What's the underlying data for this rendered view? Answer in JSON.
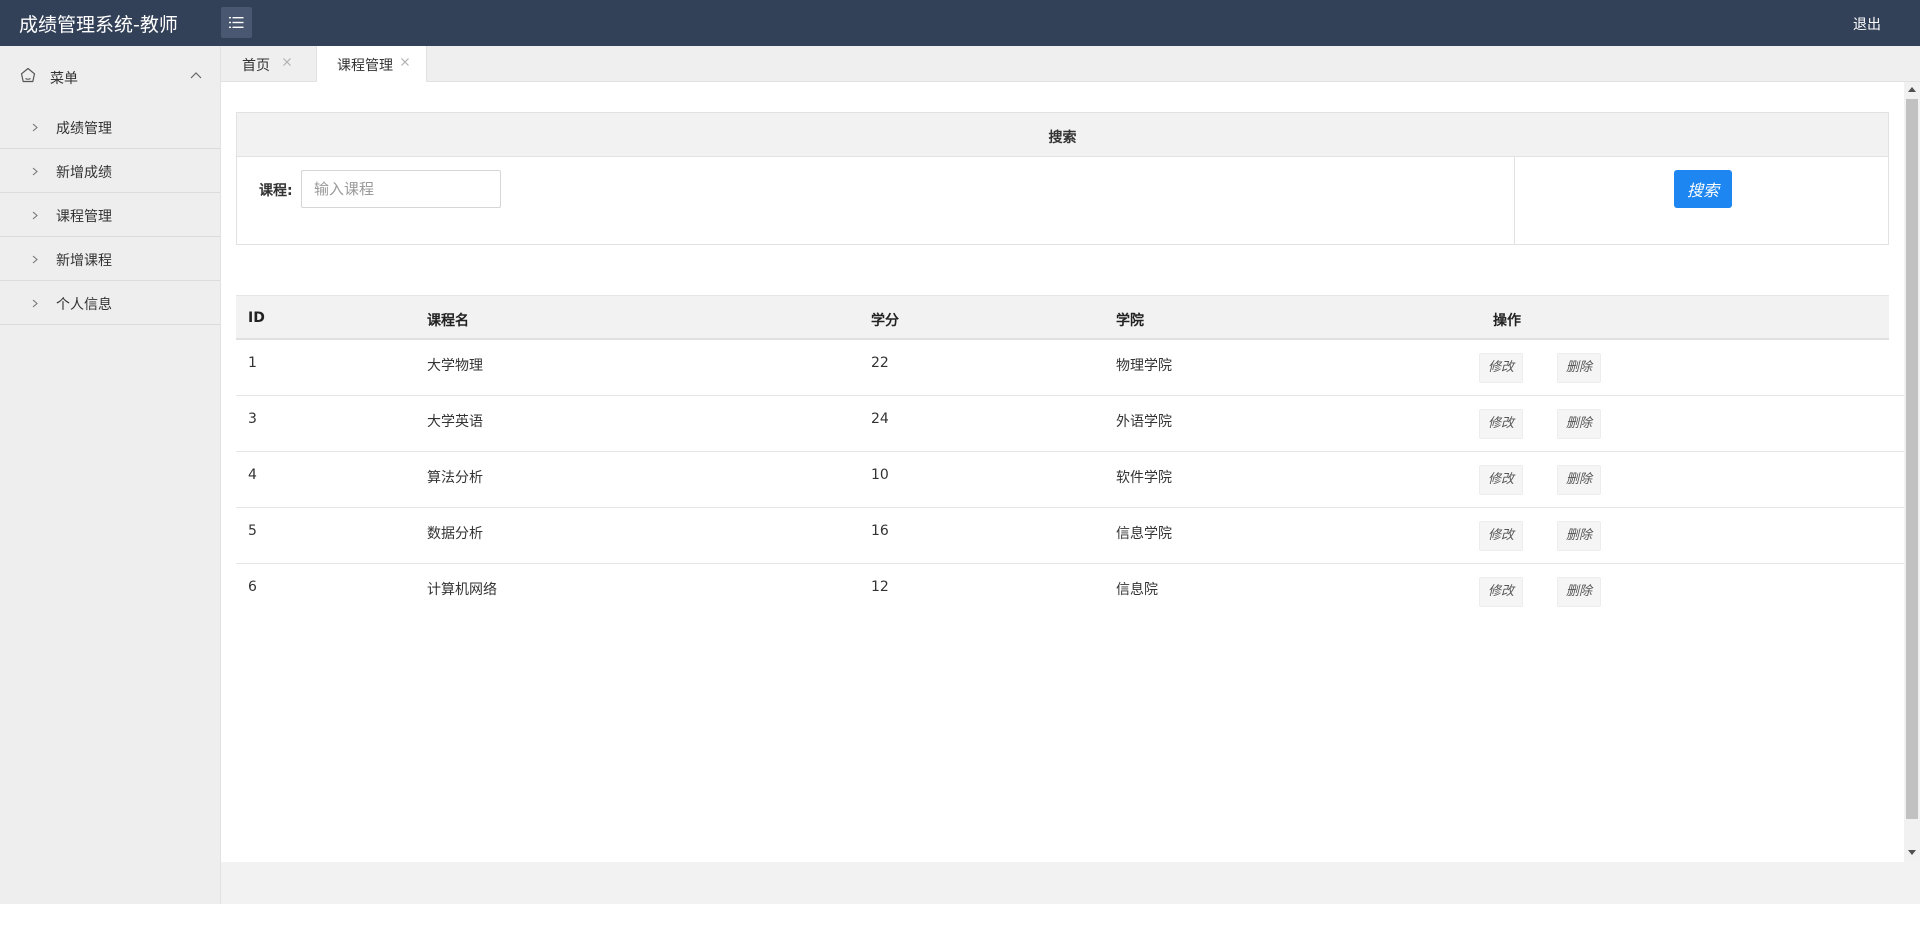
{
  "header": {
    "app_title": "成绩管理系统-教师",
    "logout_label": "退出"
  },
  "sidebar": {
    "menu_label": "菜单",
    "items": [
      {
        "label": "成绩管理"
      },
      {
        "label": "新增成绩"
      },
      {
        "label": "课程管理"
      },
      {
        "label": "新增课程"
      },
      {
        "label": "个人信息"
      }
    ]
  },
  "tabs": [
    {
      "label": "首页",
      "active": false
    },
    {
      "label": "课程管理",
      "active": true
    }
  ],
  "search": {
    "title": "搜索",
    "course_label": "课程:",
    "course_placeholder": "输入课程",
    "course_value": "",
    "button_label": "搜索"
  },
  "table": {
    "columns": [
      "ID",
      "课程名",
      "学分",
      "学院",
      "操作"
    ],
    "rows": [
      {
        "id": "1",
        "name": "大学物理",
        "credit": "22",
        "college": "物理学院"
      },
      {
        "id": "3",
        "name": "大学英语",
        "credit": "24",
        "college": "外语学院"
      },
      {
        "id": "4",
        "name": "算法分析",
        "credit": "10",
        "college": "软件学院"
      },
      {
        "id": "5",
        "name": "数据分析",
        "credit": "16",
        "college": "信息学院"
      },
      {
        "id": "6",
        "name": "计算机网络",
        "credit": "12",
        "college": "信息院"
      }
    ],
    "edit_label": "修改",
    "delete_label": "删除"
  },
  "colors": {
    "header_bg": "#334158",
    "sidebar_bg": "#eeeeee",
    "primary_button": "#1e86f0"
  }
}
